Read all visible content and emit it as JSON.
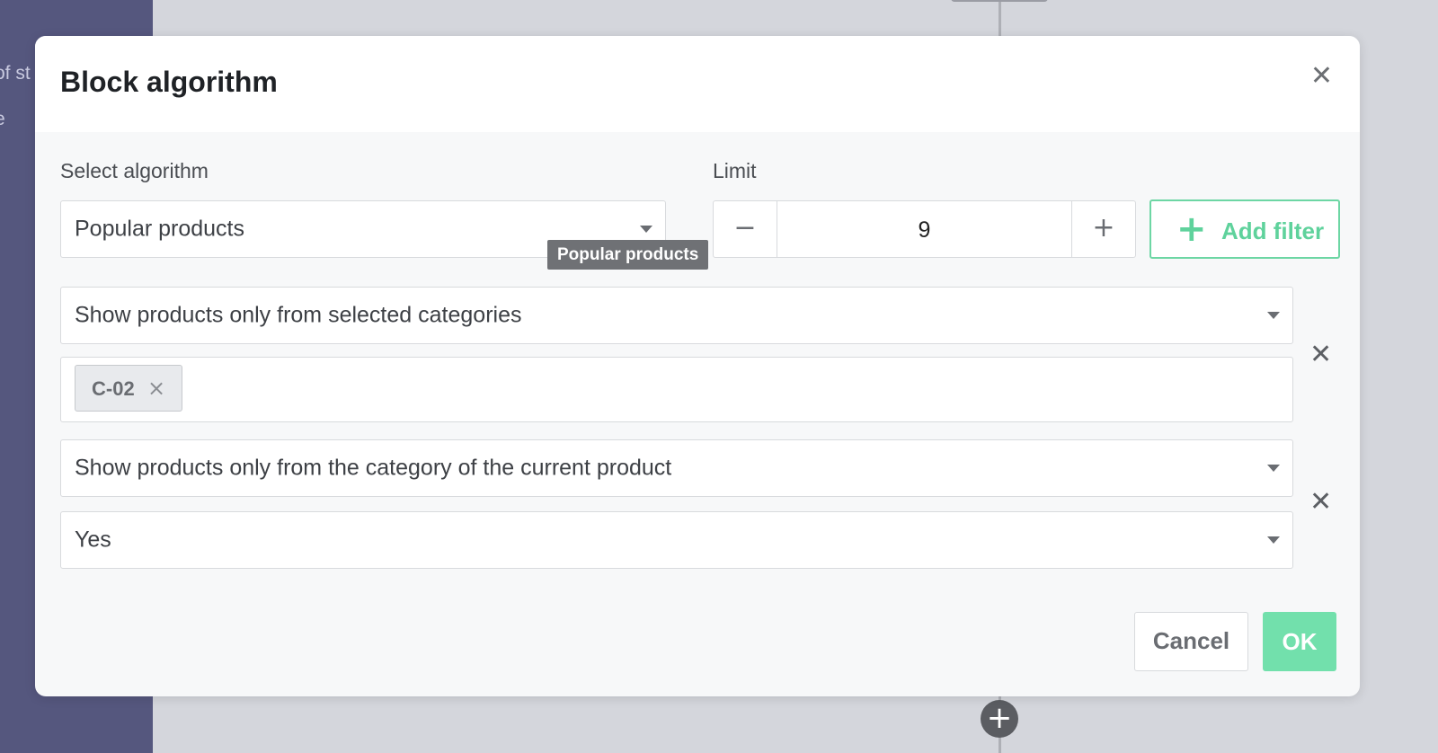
{
  "background": {
    "sidebar_lines": [
      "of st",
      "e"
    ]
  },
  "modal": {
    "title": "Block algorithm",
    "close_icon": "close-icon"
  },
  "algorithm": {
    "label": "Select algorithm",
    "value": "Popular products",
    "tooltip": "Popular products"
  },
  "limit": {
    "label": "Limit",
    "value": "9",
    "minus": "−",
    "plus": "+"
  },
  "add_filter": {
    "plus": "+",
    "label": "Add filter"
  },
  "filters": [
    {
      "select": "Show products only from selected categories",
      "tags": [
        {
          "label": "C-02",
          "remove": "×"
        }
      ]
    },
    {
      "select": "Show products only from the category of the current product",
      "value_select": "Yes"
    }
  ],
  "filter_remove_glyph": "✕",
  "footer": {
    "cancel": "Cancel",
    "ok": "OK"
  },
  "colors": {
    "accent": "#6dd6a4",
    "ok_button": "#72e0ac",
    "sidebar": "#55577e"
  }
}
